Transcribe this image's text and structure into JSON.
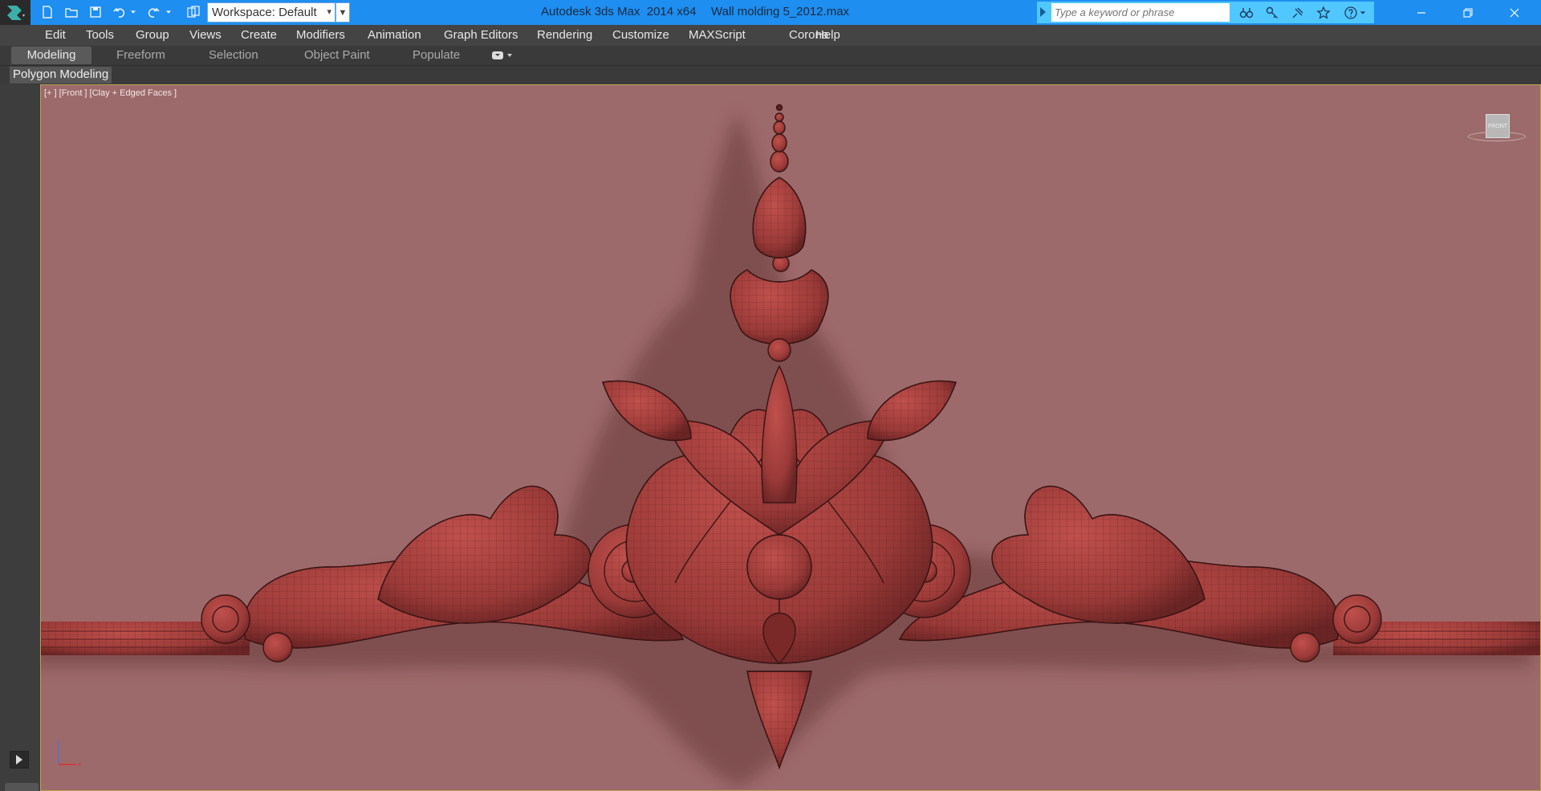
{
  "titlebar": {
    "app_title": "Autodesk 3ds Max  2014 x64",
    "file_title": "Wall molding 5_2012.max",
    "workspace_label": "Workspace: Default",
    "search_placeholder": "Type a keyword or phrase",
    "accent_color": "#1e8ef0"
  },
  "quick_access": [
    "new-icon",
    "open-icon",
    "save-icon",
    "undo-icon",
    "redo-icon",
    "project-folder-icon"
  ],
  "window_controls": [
    "minimize-icon",
    "maximize-icon",
    "close-icon"
  ],
  "menu": {
    "items": [
      {
        "label": "Edit"
      },
      {
        "label": "Tools"
      },
      {
        "label": "Group"
      },
      {
        "label": "Views"
      },
      {
        "label": "Create"
      },
      {
        "label": "Modifiers"
      },
      {
        "label": "Animation"
      },
      {
        "label": "Graph Editors"
      },
      {
        "label": "Rendering"
      },
      {
        "label": "Customize"
      },
      {
        "label": "MAXScript"
      },
      {
        "label": "Corona"
      },
      {
        "label": "Help"
      }
    ]
  },
  "ribbon": {
    "tabs": [
      {
        "label": "Modeling",
        "active": true
      },
      {
        "label": "Freeform",
        "active": false
      },
      {
        "label": "Selection",
        "active": false
      },
      {
        "label": "Object Paint",
        "active": false
      },
      {
        "label": "Populate",
        "active": false
      }
    ],
    "panel_label": "Polygon Modeling"
  },
  "viewport": {
    "label": "[+ ] [Front ] [Clay + Edged Faces ]",
    "viewcube_face": "FRONT",
    "background_color": "#9d6a6b",
    "model_color": "#a8413f",
    "axis_z": "z",
    "axis_x": "x"
  }
}
